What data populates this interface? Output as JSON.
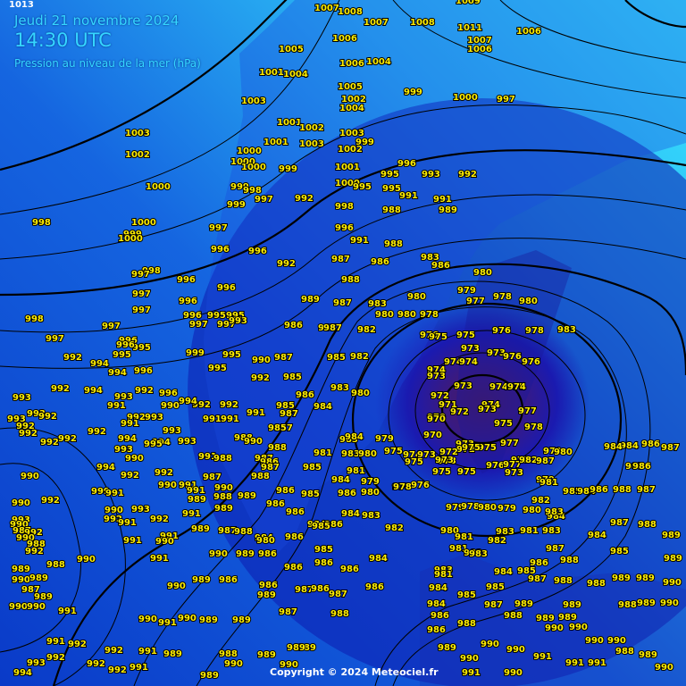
{
  "header": {
    "date": "Jeudi 21 novembre 2024",
    "time": "14:30 UTC",
    "subtitle": "Pression au niveau de la mer (hPa)"
  },
  "corner_value": "1013",
  "copyright": "Copyright © 2024 Meteociel.fr",
  "colors": {
    "high_pressure": "#33e8ff",
    "low_pressure": "#0a1fa0",
    "depression_core": "#4a1a60",
    "isobar": "#000000",
    "label": "#ffee00"
  },
  "low_center": {
    "pressure_hpa": "970"
  },
  "pressure_labels": [
    "1013",
    "1007",
    "1008",
    "1009",
    "1011",
    "1006",
    "1005",
    "1004",
    "1003",
    "1002",
    "1001",
    "1000",
    "999",
    "998",
    "997",
    "996",
    "995",
    "994",
    "993",
    "992",
    "991",
    "990",
    "989",
    "988",
    "987",
    "986",
    "985",
    "984",
    "983",
    "982",
    "981",
    "980",
    "979",
    "978",
    "977",
    "976",
    "975",
    "974",
    "973",
    "972",
    "971",
    "970"
  ]
}
